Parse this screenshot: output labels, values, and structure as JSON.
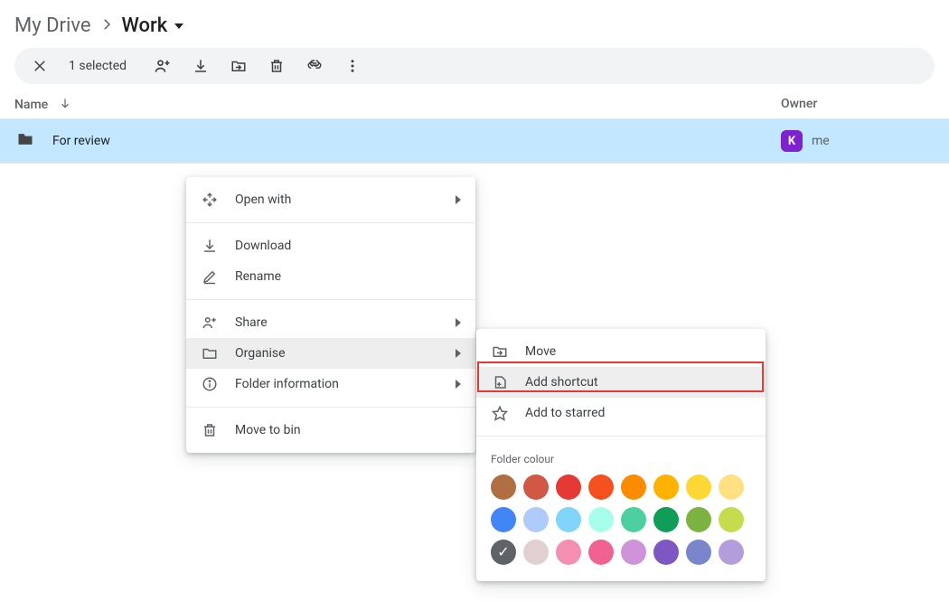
{
  "breadcrumb": {
    "root": "My Drive",
    "current": "Work"
  },
  "toolbar": {
    "selected_text": "1 selected"
  },
  "columns": {
    "name": "Name",
    "owner": "Owner"
  },
  "row": {
    "name": "For review",
    "owner": "me",
    "avatar_letter": "K"
  },
  "context_menu": {
    "open_with": "Open with",
    "download": "Download",
    "rename": "Rename",
    "share": "Share",
    "organise": "Organise",
    "folder_info": "Folder information",
    "move_to_bin": "Move to bin"
  },
  "submenu": {
    "move": "Move",
    "add_shortcut": "Add shortcut",
    "add_to_starred": "Add to starred",
    "folder_colour_label": "Folder colour"
  },
  "colors": [
    "#b06f43",
    "#d15845",
    "#e53935",
    "#f4511e",
    "#fb8c00",
    "#ffb300",
    "#fdd835",
    "#ffe082",
    "#4285f4",
    "#aecbfa",
    "#81d4fa",
    "#a7ffeb",
    "#4dd0a1",
    "#0f9d58",
    "#7cb342",
    "#c6dc4e",
    "#5f6368",
    "#e0d0d0",
    "#f48fb1",
    "#f06292",
    "#ce93d8",
    "#7e57c2",
    "#7986cb",
    "#b39ddb"
  ],
  "selected_color_index": 16
}
